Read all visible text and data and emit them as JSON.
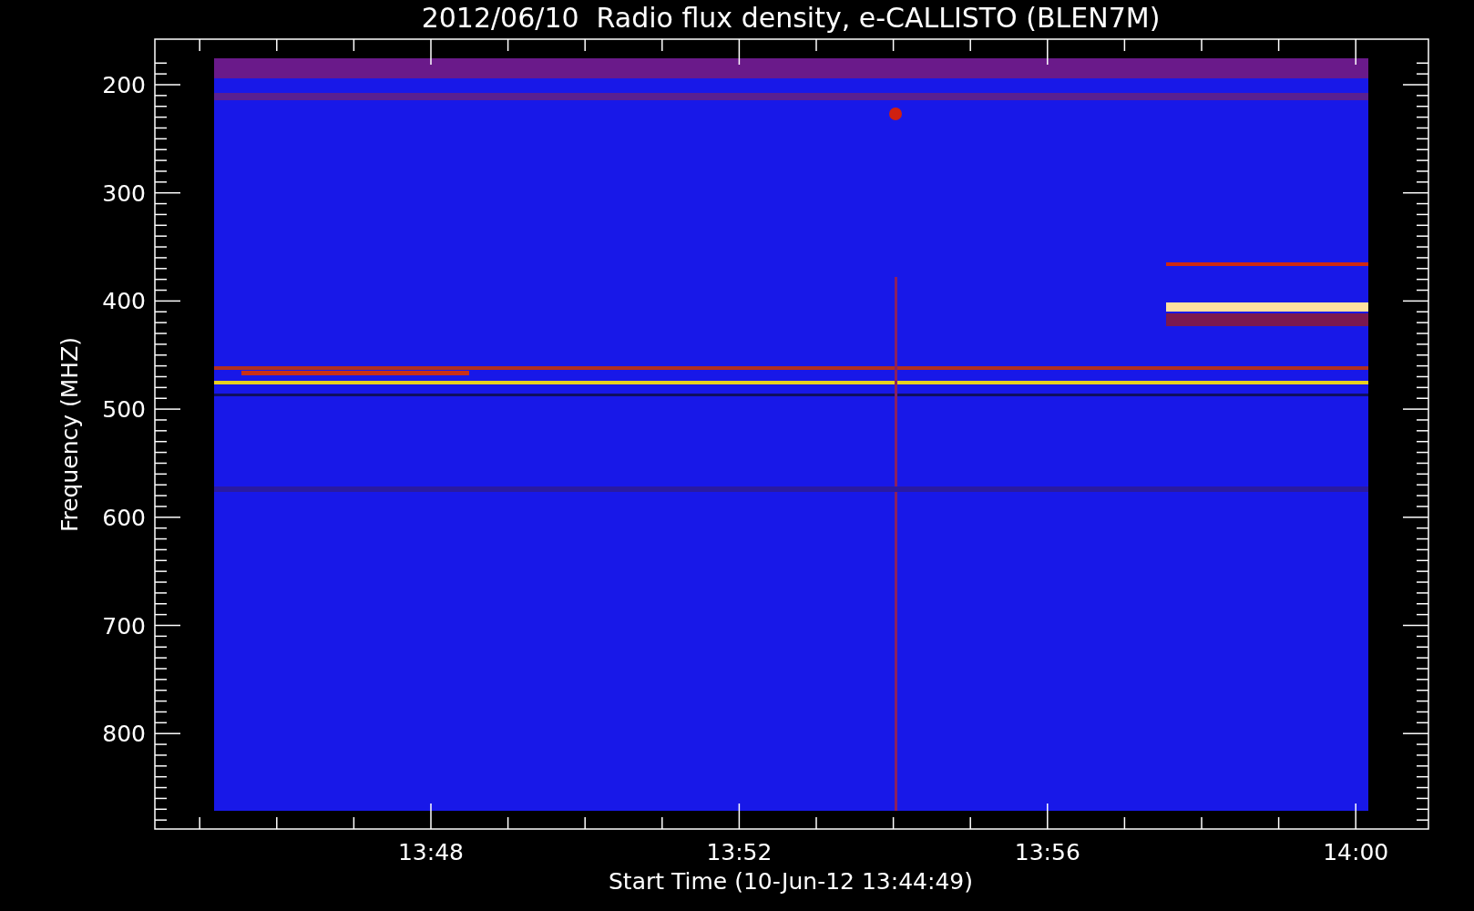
{
  "title": "2012/06/10  Radio flux density, e-CALLISTO (BLEN7M)",
  "y_axis": {
    "label": "Frequency (MHZ)",
    "ticks": [
      "200",
      "300",
      "400",
      "500",
      "600",
      "700",
      "800"
    ]
  },
  "x_axis": {
    "label": "Start Time (10-Jun-12 13:44:49)",
    "ticks": [
      "13:48",
      "13:52",
      "13:56",
      "14:00"
    ]
  }
}
